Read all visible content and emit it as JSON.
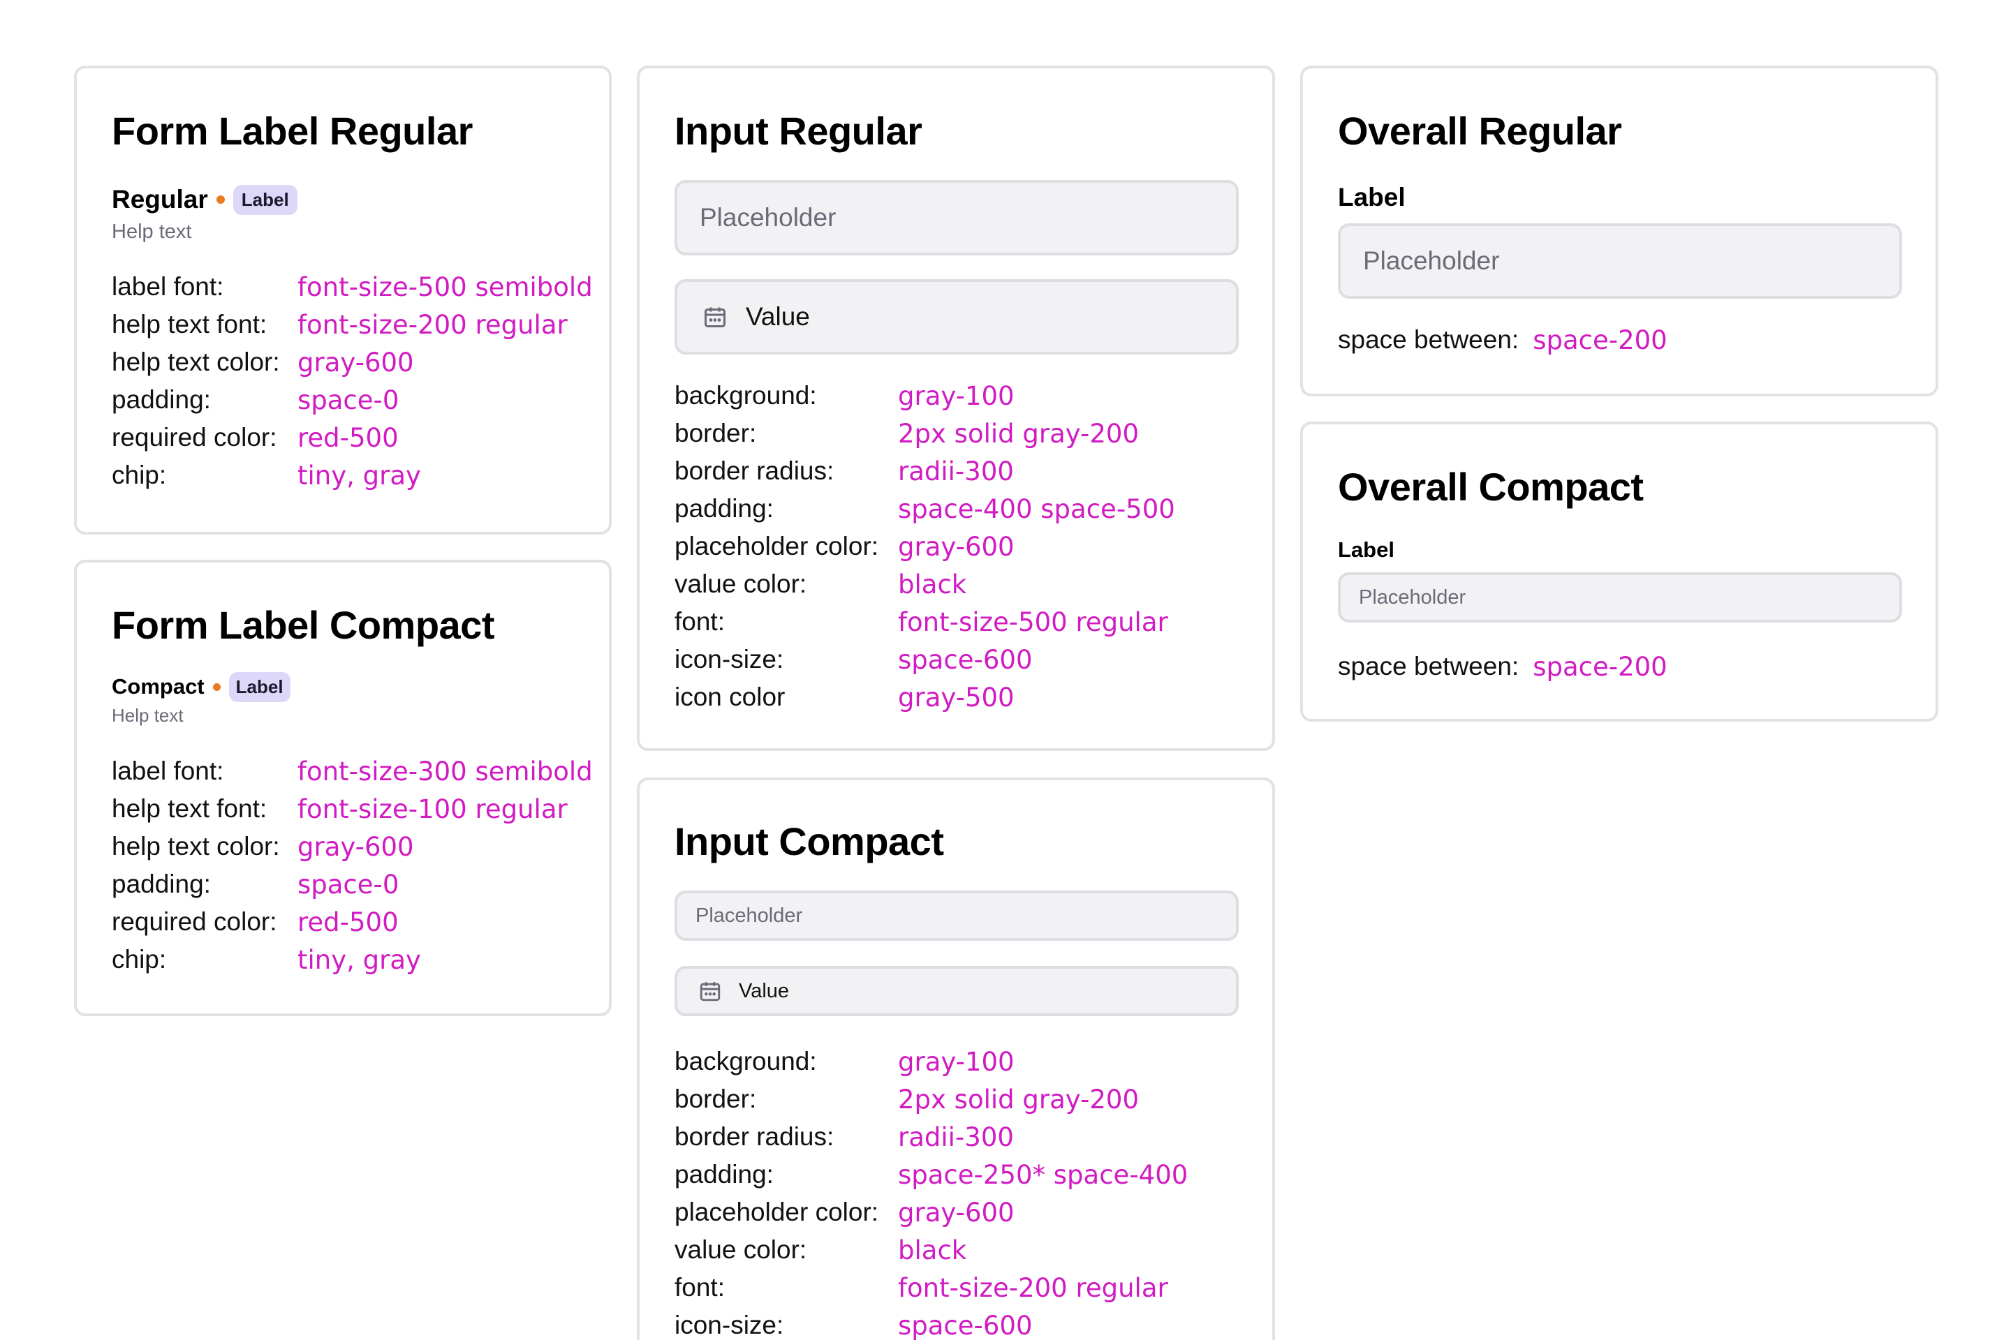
{
  "form_label_regular": {
    "title": "Form Label Regular",
    "label": "Regular",
    "chip": "Label",
    "help": "Help text",
    "specs": [
      {
        "key": "label font:",
        "value": "font-size-500 semibold"
      },
      {
        "key": "help text font:",
        "value": "font-size-200 regular"
      },
      {
        "key": "help text color:",
        "value": "gray-600"
      },
      {
        "key": "padding:",
        "value": "space-0"
      },
      {
        "key": "required color:",
        "value": "red-500"
      },
      {
        "key": "chip:",
        "value": "tiny, gray"
      }
    ]
  },
  "form_label_compact": {
    "title": "Form Label Compact",
    "label": "Compact",
    "chip": "Label",
    "help": "Help text",
    "specs": [
      {
        "key": "label font:",
        "value": "font-size-300 semibold"
      },
      {
        "key": "help text font:",
        "value": "font-size-100 regular"
      },
      {
        "key": "help text color:",
        "value": "gray-600"
      },
      {
        "key": "padding:",
        "value": "space-0"
      },
      {
        "key": "required color:",
        "value": "red-500"
      },
      {
        "key": "chip:",
        "value": "tiny, gray"
      }
    ]
  },
  "input_regular": {
    "title": "Input Regular",
    "placeholder": "Placeholder",
    "value": "Value",
    "specs": [
      {
        "key": "background:",
        "value": "gray-100"
      },
      {
        "key": "border:",
        "value": "2px solid gray-200"
      },
      {
        "key": "border radius:",
        "value": "radii-300"
      },
      {
        "key": "padding:",
        "value": "space-400 space-500"
      },
      {
        "key": "placeholder color:",
        "value": "gray-600"
      },
      {
        "key": "value color:",
        "value": "black"
      },
      {
        "key": "font:",
        "value": "font-size-500 regular"
      },
      {
        "key": "icon-size:",
        "value": "space-600"
      },
      {
        "key": "icon color",
        "value": "gray-500"
      }
    ]
  },
  "input_compact": {
    "title": "Input Compact",
    "placeholder": "Placeholder",
    "value": "Value",
    "specs": [
      {
        "key": "background:",
        "value": "gray-100"
      },
      {
        "key": "border:",
        "value": "2px solid gray-200"
      },
      {
        "key": "border radius:",
        "value": "radii-300"
      },
      {
        "key": "padding:",
        "value": "space-250* space-400"
      },
      {
        "key": "placeholder color:",
        "value": "gray-600"
      },
      {
        "key": "value color:",
        "value": "black"
      },
      {
        "key": "font:",
        "value": "font-size-200 regular"
      },
      {
        "key": "icon-size:",
        "value": "space-600"
      }
    ]
  },
  "overall_regular": {
    "title": "Overall Regular",
    "label": "Label",
    "placeholder": "Placeholder",
    "spacing_key": "space between:",
    "spacing_value": "space-200"
  },
  "overall_compact": {
    "title": "Overall Compact",
    "label": "Label",
    "placeholder": "Placeholder",
    "spacing_key": "space between:",
    "spacing_value": "space-200"
  },
  "colors": {
    "accent_value": "#d11bc3",
    "required_dot": "#ea7a1f",
    "chip_bg": "#ddd8fa",
    "input_bg": "#f2f2f4",
    "card_border": "#e2e2e6"
  },
  "icons": {
    "input_leading": "calendar-icon"
  }
}
